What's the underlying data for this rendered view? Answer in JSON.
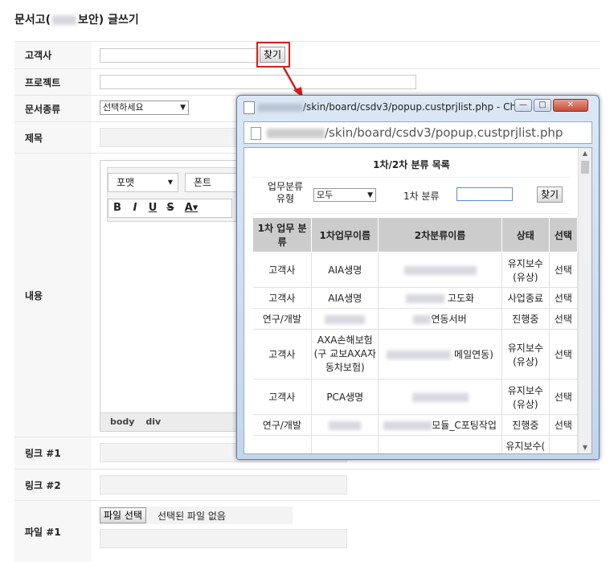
{
  "page": {
    "title_prefix": "문서고(",
    "title_suffix": "보안) 글쓰기"
  },
  "form": {
    "customer_label": "고객사",
    "find_button": "찾기",
    "project_label": "프로젝트",
    "doctype_label": "문서종류",
    "doctype_selected": "선택하세요",
    "subject_label": "제목",
    "content_label": "내용",
    "format_dropdown": "포맷",
    "font_dropdown": "폰트",
    "status_tags": [
      "body",
      "div"
    ],
    "link1_label": "링크 #1",
    "link2_label": "링크 #2",
    "file1_label": "파일 #1",
    "file_button": "파일 선택",
    "file_none": "선택된 파일 없음"
  },
  "popup": {
    "window_title": "/skin/board/csdv3/popup.custprjlist.php - Ch...",
    "url": "/skin/board/csdv3/popup.custprjlist.php",
    "heading": "1차/2차 분류 목록",
    "type_label": "업무분류 유형",
    "type_value": "모두",
    "primary_label": "1차 분류",
    "search_button": "찾기",
    "columns": [
      "1차 업무 분류",
      "1차업무이름",
      "2차분류이름",
      "상태",
      "선택"
    ],
    "rows": [
      {
        "cat": "고객사",
        "name": "AIA생명",
        "sub": "",
        "status": "유지보수(유상)",
        "select": "선택"
      },
      {
        "cat": "고객사",
        "name": "AIA생명",
        "sub": "고도화",
        "status": "사업종료",
        "select": "선택"
      },
      {
        "cat": "연구/개발",
        "name": "",
        "sub": "연동서버",
        "status": "진행중",
        "select": "선택"
      },
      {
        "cat": "고객사",
        "name": "AXA손해보험(구 교보AXA자동차보험)",
        "sub": "메일연동)",
        "status": "유지보수(유상)",
        "select": "선택"
      },
      {
        "cat": "고객사",
        "name": "PCA생명",
        "sub": "",
        "status": "유지보수(유상)",
        "select": "선택"
      },
      {
        "cat": "연구/개발",
        "name": "",
        "sub": "모듈_C포팅작업",
        "status": "진행중",
        "select": "선택"
      },
      {
        "cat": "",
        "name": "",
        "sub": "",
        "status": "유지보수(",
        "select": ""
      }
    ]
  },
  "colors": {
    "highlight": "#d31f1f",
    "arrow": "#d31f1f",
    "header_bg": "#cccccc"
  }
}
